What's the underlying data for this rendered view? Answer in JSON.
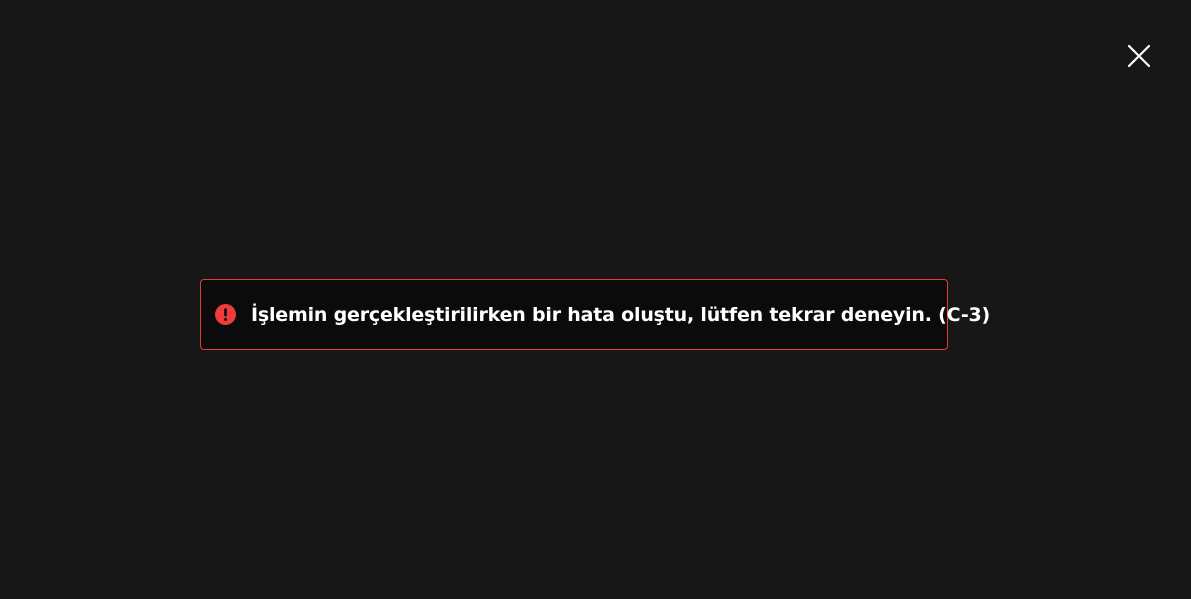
{
  "window": {
    "background_color": "#171717"
  },
  "close_button": {
    "icon": "close-icon",
    "color": "#ffffff"
  },
  "error_alert": {
    "icon": "exclamation-circle-icon",
    "icon_color": "#ef3b3b",
    "border_color": "#e53935",
    "message": "İşlemin gerçekleştirilirken bir hata oluştu, lütfen tekrar deneyin. (C-3)"
  }
}
